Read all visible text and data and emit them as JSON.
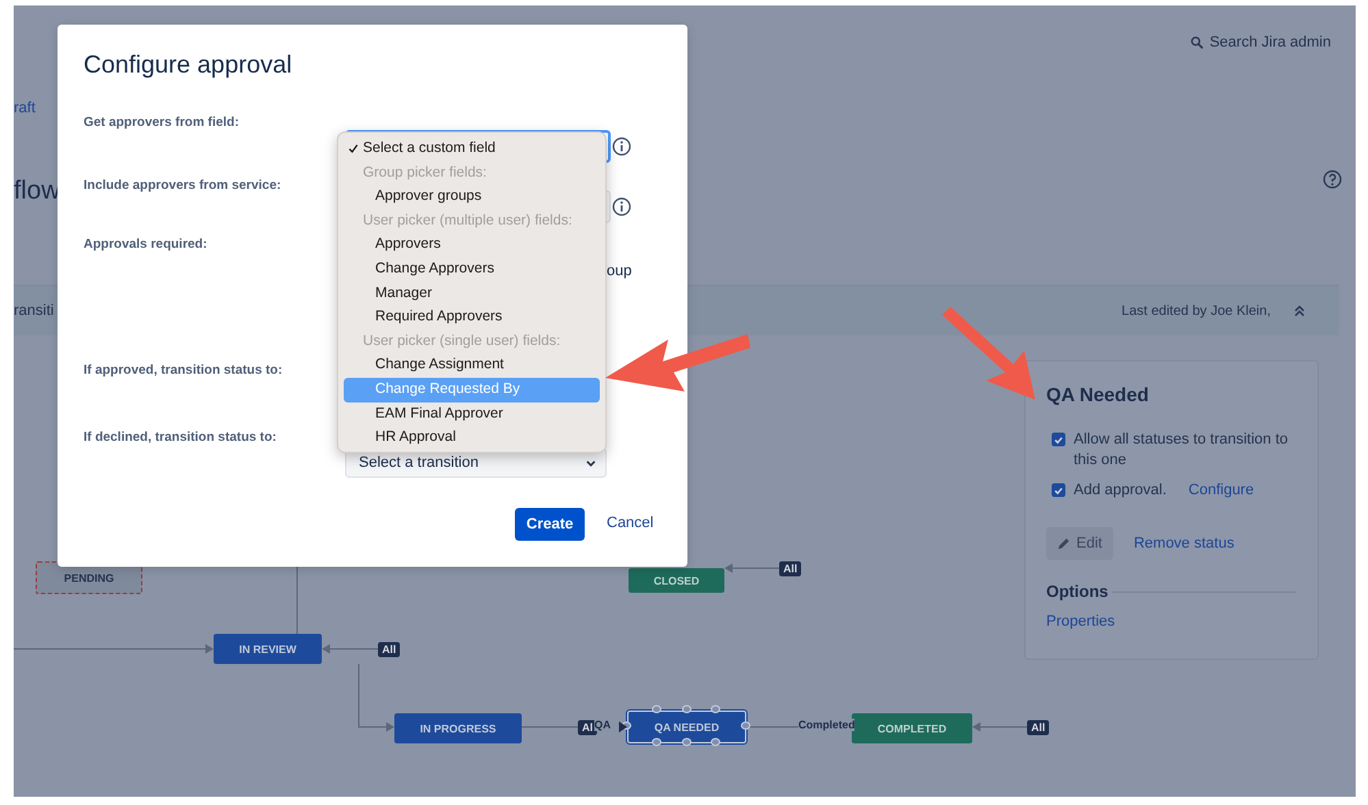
{
  "page": {
    "search_label": "Search Jira admin",
    "breadcrumb": "raft",
    "heading": "flow",
    "toolbar_label": "ransiti",
    "last_edited": "Last edited by Joe Klein,"
  },
  "diagram": {
    "nodes": [
      {
        "label": "PENDING",
        "kind": "draft",
        "selected": false
      },
      {
        "label": "CLOSED",
        "kind": "done",
        "selected": false
      },
      {
        "label": "IN REVIEW",
        "kind": "progress",
        "selected": false
      },
      {
        "label": "IN PROGRESS",
        "kind": "progress",
        "selected": false
      },
      {
        "label": "QA NEEDED",
        "kind": "progress",
        "selected": true
      },
      {
        "label": "COMPLETED",
        "kind": "done",
        "selected": false
      }
    ],
    "badges": [
      "All",
      "All",
      "Al",
      "All"
    ],
    "transition_labels": [
      "QA",
      "Completed"
    ]
  },
  "status_panel": {
    "title": "QA Needed",
    "options": [
      {
        "label": "Allow all statuses to transition to this one",
        "checked": true
      },
      {
        "label": "Add approval.",
        "checked": true,
        "link": "Configure"
      }
    ],
    "edit_button": "Edit",
    "remove_link": "Remove status",
    "section_title": "Options",
    "section_link": "Properties"
  },
  "dialog": {
    "title": "Configure approval",
    "fields": [
      {
        "label": "Get approvers from field:"
      },
      {
        "label": "Include approvers from service:"
      },
      {
        "label": "Approvals required:",
        "visible_text": "oup"
      },
      {
        "label": "If approved, transition status to:"
      },
      {
        "label": "If declined, transition status to:",
        "value": "Select a transition"
      }
    ],
    "dropdown": [
      {
        "label": "Select a custom field",
        "kind": "option",
        "checked": true,
        "selected": false
      },
      {
        "label": "Group picker fields:",
        "kind": "group"
      },
      {
        "label": "Approver groups",
        "kind": "option",
        "checked": false,
        "selected": false
      },
      {
        "label": "User picker (multiple user) fields:",
        "kind": "group"
      },
      {
        "label": "Approvers",
        "kind": "option",
        "checked": false,
        "selected": false
      },
      {
        "label": "Change Approvers",
        "kind": "option",
        "checked": false,
        "selected": false
      },
      {
        "label": "Manager",
        "kind": "option",
        "checked": false,
        "selected": false
      },
      {
        "label": "Required Approvers",
        "kind": "option",
        "checked": false,
        "selected": false
      },
      {
        "label": "User picker (single user) fields:",
        "kind": "group"
      },
      {
        "label": "Change Assignment",
        "kind": "option",
        "checked": false,
        "selected": false
      },
      {
        "label": "Change Requested By",
        "kind": "option",
        "checked": false,
        "selected": true
      },
      {
        "label": "EAM Final Approver",
        "kind": "option",
        "checked": false,
        "selected": false
      },
      {
        "label": "HR Approval",
        "kind": "option",
        "checked": false,
        "selected": false
      }
    ],
    "buttons": {
      "primary": "Create",
      "secondary": "Cancel"
    }
  }
}
